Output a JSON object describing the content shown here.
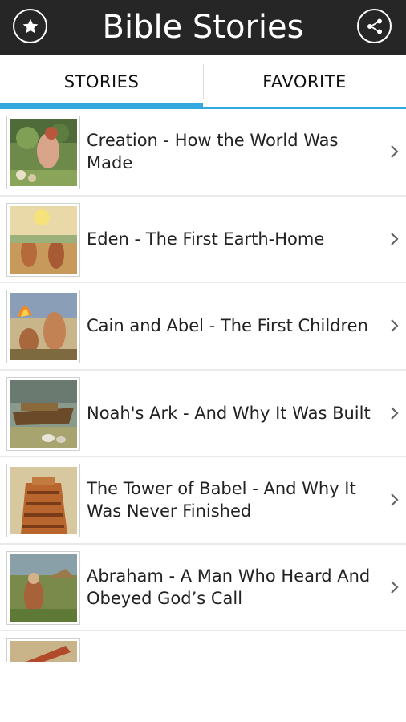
{
  "app": {
    "title": "Bible Stories"
  },
  "header": {
    "left_icon": "star-icon",
    "right_icon": "share-icon"
  },
  "tabs": [
    {
      "label": "STORIES",
      "active": true
    },
    {
      "label": "FAVORITE",
      "active": false
    }
  ],
  "stories": [
    {
      "title": "Creation - How the World Was Made"
    },
    {
      "title": "Eden - The First Earth-Home"
    },
    {
      "title": "Cain and Abel - The First Children"
    },
    {
      "title": "Noah's Ark - And Why It Was Built"
    },
    {
      "title": "The Tower of Babel - And Why It Was Never Finished"
    },
    {
      "title": "Abraham - A Man Who Heard And Obeyed God’s Call"
    }
  ],
  "colors": {
    "appbar": "#262626",
    "accent": "#33a9e0"
  }
}
